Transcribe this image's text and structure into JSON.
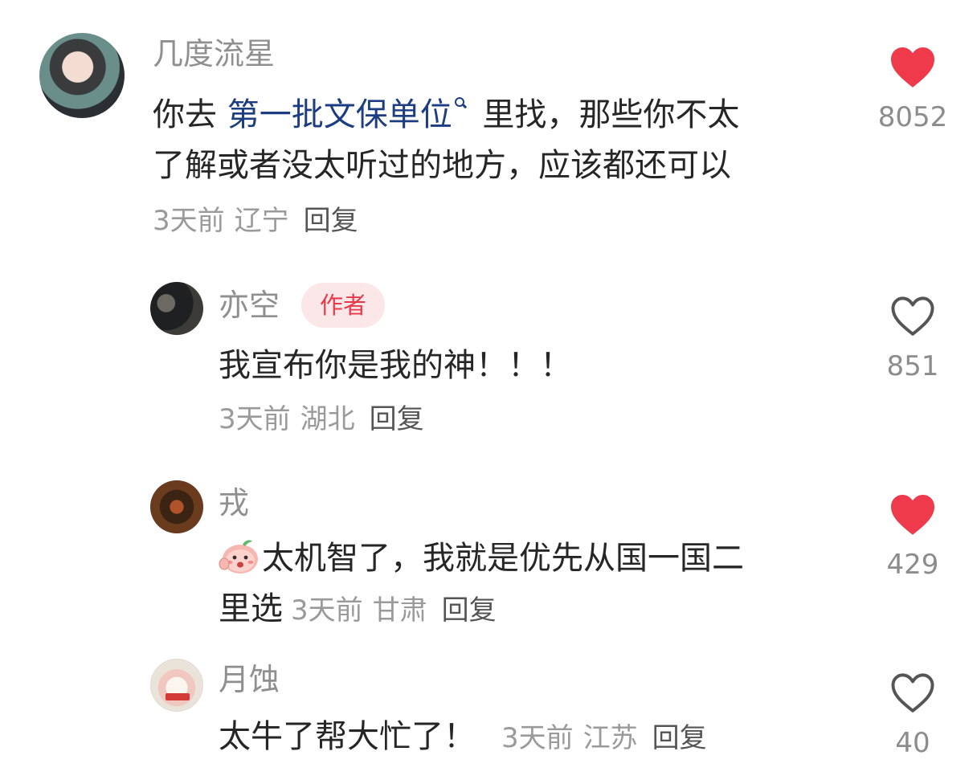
{
  "colors": {
    "liked": "#ee3a4b",
    "unliked_outline": "#555555",
    "link": "#1d3d82",
    "badge_bg": "#fbe6e8",
    "badge_text": "#e8394a"
  },
  "comments": [
    {
      "username": "几度流星",
      "text_before": "你去 ",
      "link_text": "第一批文保单位",
      "text_after": " 里找，那些你不太",
      "text_line2": "了解或者没太听过的地方，应该都还可以",
      "time": "3天前",
      "location": "辽宁",
      "reply": "回复",
      "likes": "8052",
      "liked": true,
      "avatar": "avatar-icon"
    },
    {
      "username": "亦空",
      "badge": "作者",
      "text": "我宣布你是我的神！！！",
      "time": "3天前",
      "location": "湖北",
      "reply": "回复",
      "likes": "851",
      "liked": false,
      "avatar": "avatar-icon"
    },
    {
      "username": "戎",
      "emoji": "peach-emoji-icon",
      "text_line1": "太机智了，我就是优先从国一国二",
      "text_line2": "里选",
      "time": "3天前",
      "location": "甘肃",
      "reply": "回复",
      "likes": "429",
      "liked": true,
      "avatar": "avatar-icon"
    },
    {
      "username": "月蚀",
      "text": "太牛了帮大忙了！",
      "time": "3天前",
      "location": "江苏",
      "reply": "回复",
      "likes": "40",
      "liked": false,
      "avatar": "avatar-icon"
    }
  ]
}
